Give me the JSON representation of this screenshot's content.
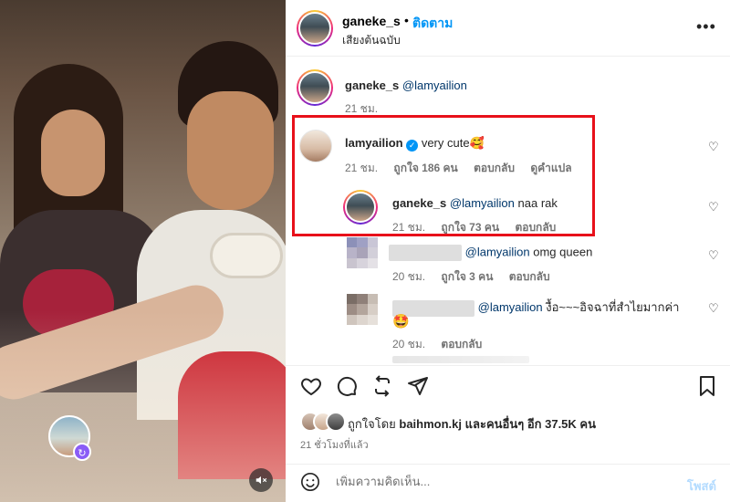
{
  "media": {
    "remix_icon": "remix-icon",
    "mute_icon": "speaker-muted-icon"
  },
  "header": {
    "username": "ganeke_s",
    "separator": "•",
    "follow_label": "ติดตาม",
    "audio_label": "เสียงต้นฉบับ",
    "more_icon": "more-horizontal-icon"
  },
  "comments": [
    {
      "username": "ganeke_s",
      "mention": "@lamyailion",
      "text": "",
      "time": "21 ชม."
    },
    {
      "username": "lamyailion",
      "verified": true,
      "text": "very cute🥰",
      "time": "21 ชม.",
      "likes": "ถูกใจ 186 คน",
      "reply": "ตอบกลับ",
      "translate": "ดูคำแปล"
    },
    {
      "username": "ganeke_s",
      "mention": "@lamyailion",
      "text": "naa rak",
      "time": "21 ชม.",
      "likes": "ถูกใจ 73 คน",
      "reply": "ตอบกลับ"
    },
    {
      "mention": "@lamyailion",
      "text": "omg queen",
      "time": "20 ชม.",
      "likes": "ถูกใจ 3 คน",
      "reply": "ตอบกลับ"
    },
    {
      "mention": "@lamyailion",
      "text": "งื้อ~~~อิจฉาที่สำไยมากค่า",
      "text2": "🤩",
      "time": "20 ชม.",
      "reply": "ตอบกลับ"
    }
  ],
  "actions": {
    "like_icon": "heart-icon",
    "comment_icon": "comment-icon",
    "share_icon": "repost-icon",
    "send_icon": "send-icon",
    "save_icon": "bookmark-icon"
  },
  "likes": {
    "prefix": "ถูกใจโดย",
    "user": "baihmon.kj",
    "suffix": "และคนอื่นๆ อีก 37.5K คน"
  },
  "time_ago": "21 ชั่วโมงที่แล้ว",
  "add_comment": {
    "placeholder": "เพิ่มความคิดเห็น...",
    "post_label": "โพสต์"
  },
  "colors": {
    "accent": "#0095f6",
    "highlight": "#e8101a",
    "verified": "#0095f6"
  }
}
